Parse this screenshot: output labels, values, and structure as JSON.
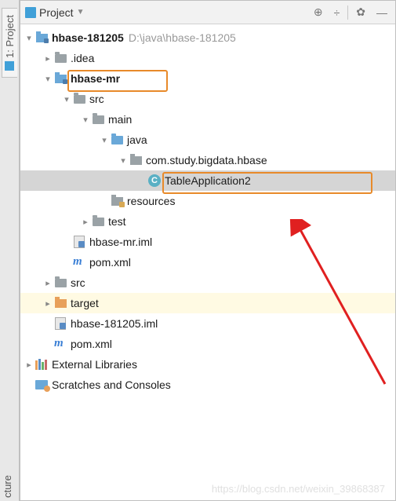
{
  "sidebar": {
    "tab_label": "1: Project",
    "bottom_label": "cture"
  },
  "toolbar": {
    "title": "Project",
    "icons": {
      "target": "⊕",
      "expand": "÷",
      "gear": "✿",
      "hide": "—"
    }
  },
  "tree": {
    "root": {
      "label": "hbase-181205",
      "path": "D:\\java\\hbase-181205",
      "children": {
        "idea": ".idea",
        "module": {
          "label": "hbase-mr",
          "src": "src",
          "main": "main",
          "java": "java",
          "pkg": "com.study.bigdata.hbase",
          "class": "TableApplication2",
          "class_letter": "C",
          "resources": "resources",
          "test": "test",
          "iml": "hbase-mr.iml",
          "pom": "pom.xml"
        },
        "src": "src",
        "target": "target",
        "iml": "hbase-181205.iml",
        "pom": "pom.xml"
      }
    },
    "external": "External Libraries",
    "scratches": "Scratches and Consoles"
  },
  "watermark": "https://blog.csdn.net/weixin_39868387"
}
